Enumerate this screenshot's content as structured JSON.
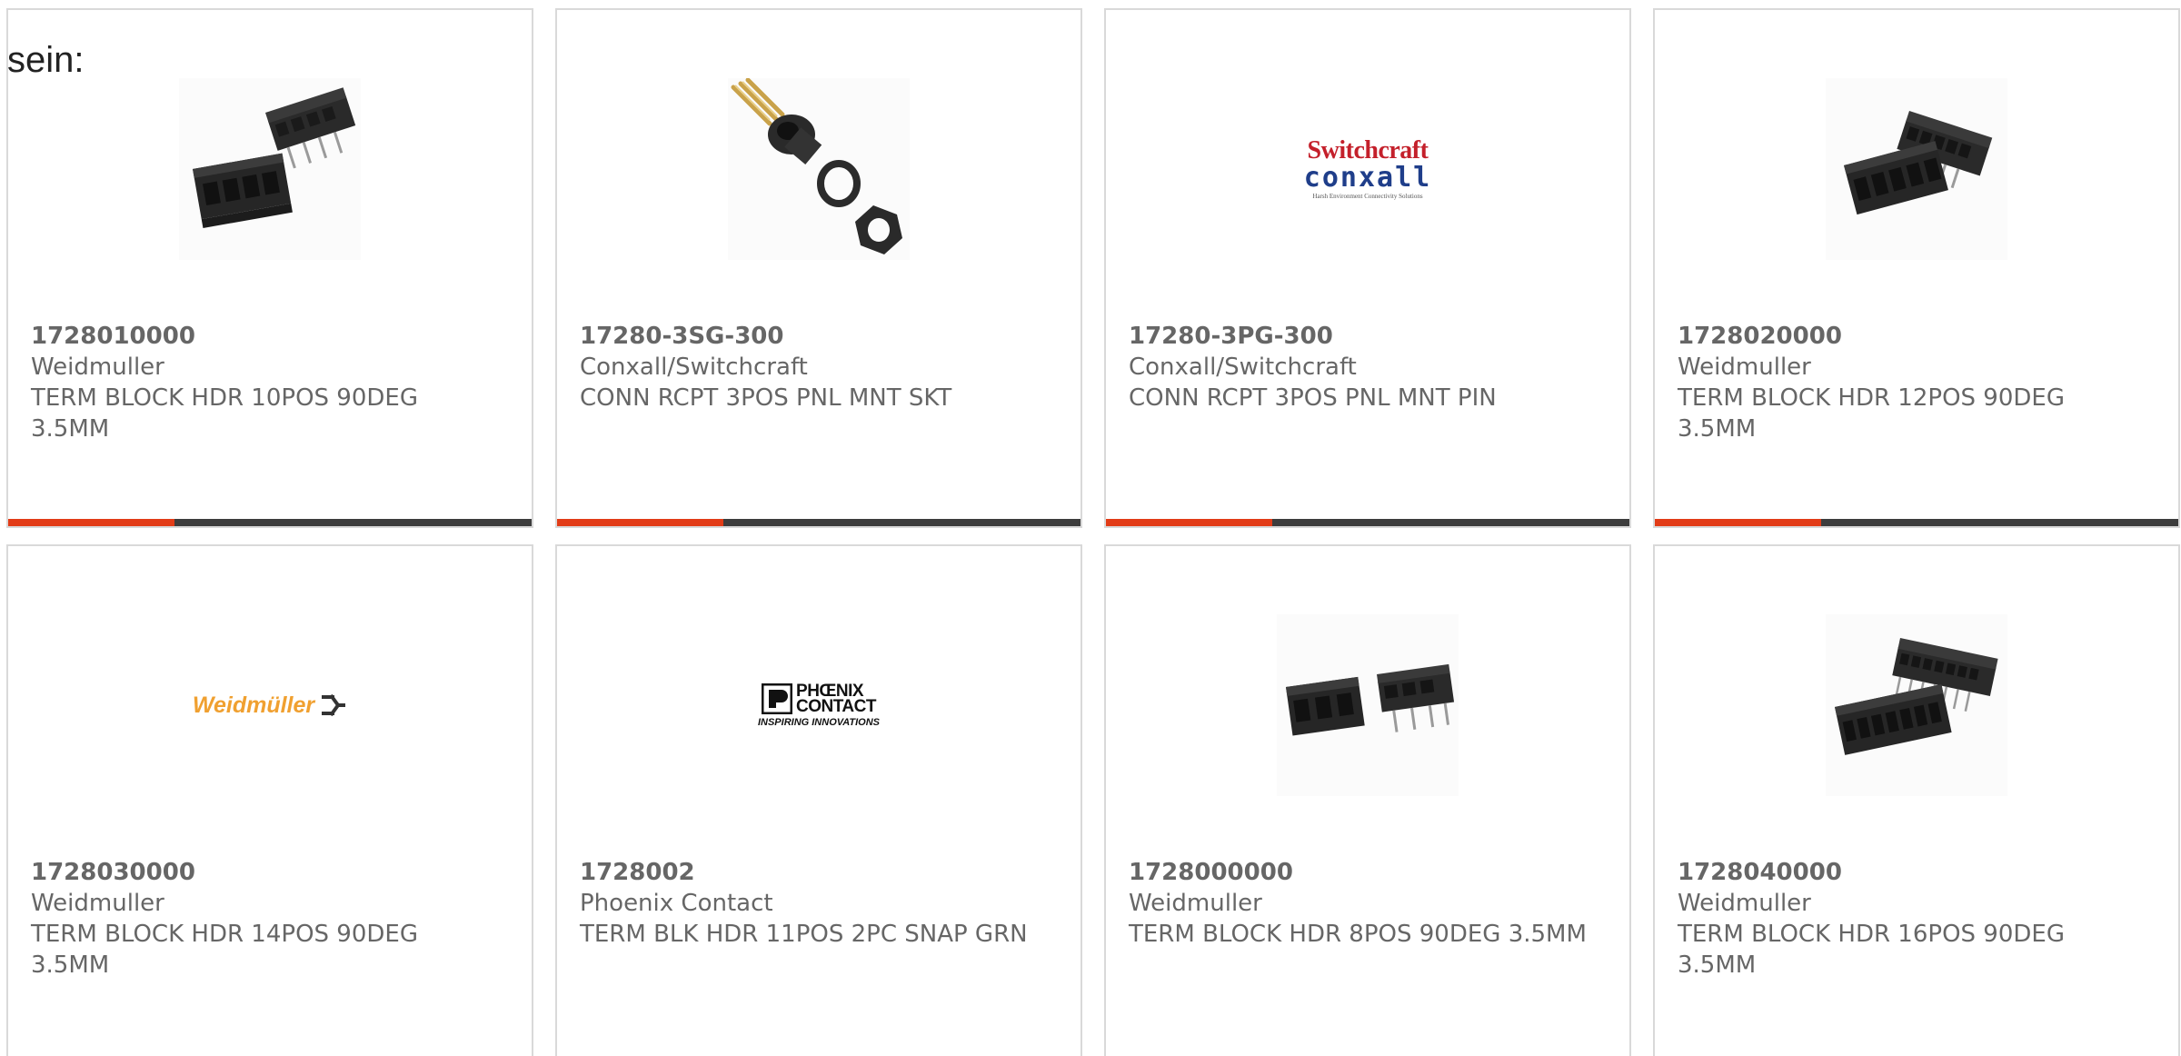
{
  "intro_text": "sein:",
  "colors": {
    "accent": "#e23c17",
    "bar_dark": "#3d3d3d",
    "border": "#d9d9d9",
    "text": "#666666"
  },
  "products": [
    {
      "part_number": "1728010000",
      "manufacturer": "Weidmuller",
      "description": "TERM BLOCK HDR 10POS 90DEG 3.5MM",
      "image": "terminal-block-10pos-photo"
    },
    {
      "part_number": "17280-3SG-300",
      "manufacturer": "Conxall/Switchcraft",
      "description": "CONN RCPT 3POS PNL MNT SKT",
      "image": "panel-mount-receptacle-photo"
    },
    {
      "part_number": "17280-3PG-300",
      "manufacturer": "Conxall/Switchcraft",
      "description": "CONN RCPT 3POS PNL MNT PIN",
      "image": "switchcraft-conxall-logo",
      "logo_line1": "Switchcraft",
      "logo_line2": "conxall",
      "logo_tagline": "Harsh Environment Connectivity Solutions"
    },
    {
      "part_number": "1728020000",
      "manufacturer": "Weidmuller",
      "description": "TERM BLOCK HDR 12POS 90DEG 3.5MM",
      "image": "terminal-block-12pos-photo"
    },
    {
      "part_number": "1728030000",
      "manufacturer": "Weidmuller",
      "description": "TERM BLOCK HDR 14POS 90DEG 3.5MM",
      "image": "weidmuller-logo",
      "logo_text": "Weidmüller"
    },
    {
      "part_number": "1728002",
      "manufacturer": "Phoenix Contact",
      "description": "TERM BLK HDR 11POS 2PC SNAP GRN",
      "image": "phoenix-contact-logo",
      "logo_line1": "PHŒNIX",
      "logo_line2": "CONTACT",
      "logo_tagline": "INSPIRING INNOVATIONS"
    },
    {
      "part_number": "1728000000",
      "manufacturer": "Weidmuller",
      "description": "TERM BLOCK HDR 8POS 90DEG 3.5MM",
      "image": "terminal-block-8pos-photo"
    },
    {
      "part_number": "1728040000",
      "manufacturer": "Weidmuller",
      "description": "TERM BLOCK HDR 16POS 90DEG 3.5MM",
      "image": "terminal-block-16pos-photo"
    }
  ]
}
